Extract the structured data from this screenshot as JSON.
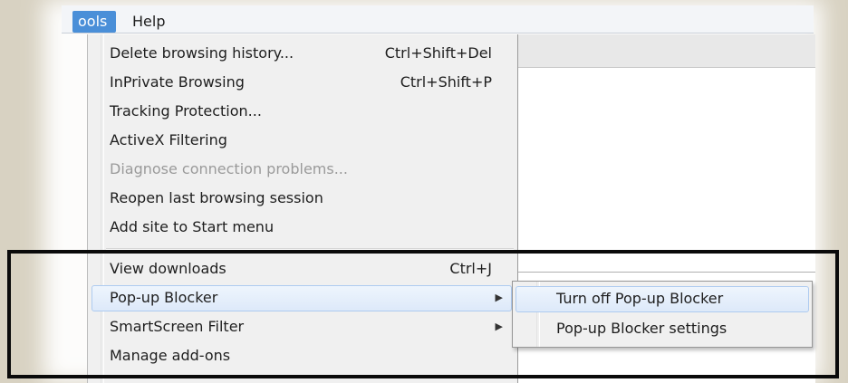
{
  "menubar": {
    "tools_label": "ools",
    "help_label": "Help"
  },
  "tools_menu": {
    "items": [
      {
        "label": "Delete browsing history...",
        "shortcut": "Ctrl+Shift+Del",
        "enabled": true
      },
      {
        "label": "InPrivate Browsing",
        "shortcut": "Ctrl+Shift+P",
        "enabled": true
      },
      {
        "label": "Tracking Protection...",
        "shortcut": "",
        "enabled": true
      },
      {
        "label": "ActiveX Filtering",
        "shortcut": "",
        "enabled": true
      },
      {
        "label": "Diagnose connection problems...",
        "shortcut": "",
        "enabled": false
      },
      {
        "label": "Reopen last browsing session",
        "shortcut": "",
        "enabled": true
      },
      {
        "label": "Add site to Start menu",
        "shortcut": "",
        "enabled": true
      },
      {
        "label": "View downloads",
        "shortcut": "Ctrl+J",
        "enabled": true
      },
      {
        "label": "Pop-up Blocker",
        "shortcut": "",
        "enabled": true,
        "submenu": true,
        "highlighted": true
      },
      {
        "label": "SmartScreen Filter",
        "shortcut": "",
        "enabled": true,
        "submenu": true
      },
      {
        "label": "Manage add-ons",
        "shortcut": "",
        "enabled": true
      }
    ],
    "arrow_glyph": "▶"
  },
  "popup_submenu": {
    "items": [
      {
        "label": "Turn off Pop-up Blocker",
        "highlighted": true
      },
      {
        "label": "Pop-up Blocker settings",
        "highlighted": false
      }
    ]
  },
  "colors": {
    "menu_bg": "#f0f0f0",
    "highlight_border": "#aecbf0",
    "tools_active_bg": "#4a8fd8",
    "annotation_box": "#0a0a0a",
    "disabled_text": "#9a9a9a"
  }
}
